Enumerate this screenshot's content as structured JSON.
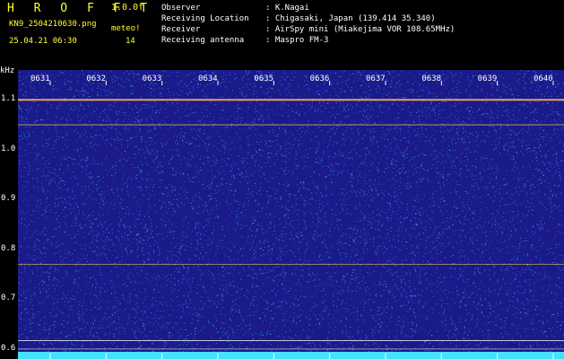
{
  "header": {
    "brand": "H R O F F T",
    "version": "1.0.0f",
    "filename": "KN9_2504210630.png",
    "meteo_label": "meteo!",
    "datetime": "25.04.21 06:30",
    "meteo_count": "14",
    "meta": [
      {
        "key": "Observer",
        "value": ": K.Nagai"
      },
      {
        "key": "Receiving Location",
        "value": ": Chigasaki, Japan (139.414 35.340)"
      },
      {
        "key": "Receiver",
        "value": ": AirSpy mini (Miakejima VOR 108.65MHz)"
      },
      {
        "key": "Receiving antenna",
        "value": ": Maspro FM-3"
      }
    ]
  },
  "spectrogram": {
    "freq_unit": "kHz",
    "y_ticks": [
      "1.1",
      "1.0",
      "0.9",
      "0.8",
      "0.7",
      "0.6"
    ],
    "y_range": [
      0.58,
      1.16
    ],
    "time_ticks": [
      "0631",
      "0632",
      "0633",
      "0634",
      "0635",
      "0636",
      "0637",
      "0638",
      "0639",
      "0640"
    ],
    "colors": {
      "background": "#1a1a8a",
      "noise": "#3a9cff",
      "signal": "#ffd83a",
      "baseline": "#45e0ff"
    }
  }
}
